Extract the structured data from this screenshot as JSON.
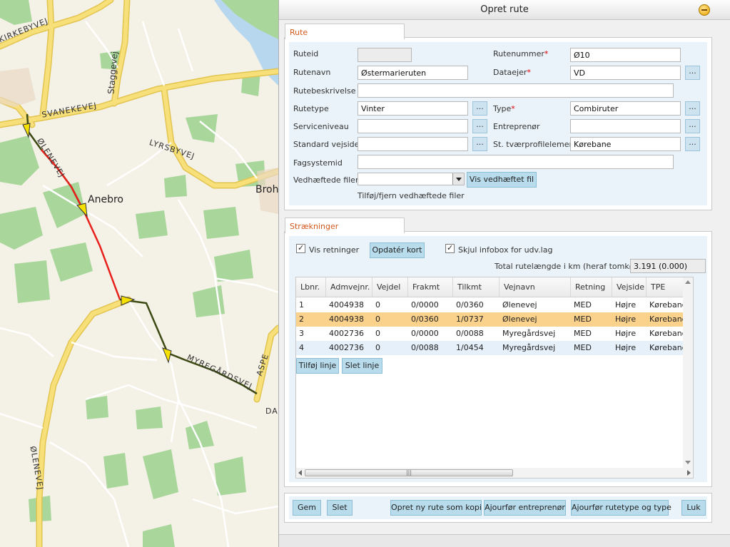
{
  "map": {
    "labels": {
      "road_1": "KIRKEBYVEJ",
      "road_2": "SVANEKEVEJ",
      "road_3": "Staggevej",
      "road_4": "LYRSBYVEJ",
      "road_5": "ØLENEVEJ",
      "town_1": "Anebro",
      "town_2": "Broh",
      "road_6": "MYREGÅRDSVEJ",
      "road_7": "ASPE",
      "road_8": "DA",
      "road_9": "ØLENEVEJ"
    },
    "colors": {
      "background": "#f4f1e6",
      "road": "#f7e07a",
      "road_border": "#e2c450",
      "green": "#a8d69b",
      "water": "#b7d7ef",
      "route_selected": "#e8201c",
      "route": "#3d4a14",
      "arrow": "#f5e000"
    }
  },
  "dialog": {
    "title": "Opret rute",
    "rute_tab": "Rute",
    "fields": {
      "ruteid_label": "Ruteid",
      "ruteid_value": "",
      "rutenummer_label": "Rutenummer",
      "rutenummer_value": "Ø10",
      "rutenavn_label": "Rutenavn",
      "rutenavn_value": "Østermarieruten",
      "dataejer_label": "Dataejer",
      "dataejer_value": "VD",
      "rutebeskrivelse_label": "Rutebeskrivelse",
      "rutebeskrivelse_value": "",
      "rutetype_label": "Rutetype",
      "rutetype_value": "Vinter",
      "type_label": "Type",
      "type_value": "Combiruter",
      "serviceniveau_label": "Serviceniveau",
      "serviceniveau_value": "",
      "entreprenor_label": "Entreprenør",
      "entreprenor_value": "",
      "standard_vejside_label": "Standard vejside",
      "standard_vejside_value": "",
      "st_tvaerprofil_label": "St. tværprofilelement",
      "st_tvaerprofil_value": "Kørebane",
      "fagsystemid_label": "Fagsystemid",
      "fagsystemid_value": "",
      "vedhaeftede_label": "Vedhæftede filer:",
      "vedhaeftede_value": "",
      "vis_vedhaeftet_button": "Vis vedhæftet fil",
      "tilfoj_fjern_text": "Tilføj/fjern vedhæftede filer",
      "required_mark": "*",
      "dots": "..."
    },
    "straekninger": {
      "tab": "Strækninger",
      "vis_retninger_label": "Vis retninger",
      "vis_retninger_checked": true,
      "opdater_kort_button": "Opdatér kort",
      "skjul_infobox_label": "Skjul infobox for udv.lag",
      "skjul_infobox_checked": true,
      "total_label": "Total rutelængde i km (heraf tomkørsel)",
      "total_value": "3.191 (0.000)",
      "columns": [
        "Lbnr.",
        "Admvejnr.",
        "Vejdel",
        "Frakmt",
        "Tilkmt",
        "Vejnavn",
        "Retning",
        "Vejside",
        "TPE"
      ],
      "rows": [
        [
          "1",
          "4004938",
          "0",
          "0/0000",
          "0/0360",
          "Ølenevej",
          "MED",
          "Højre",
          "Kørebane"
        ],
        [
          "2",
          "4004938",
          "0",
          "0/0360",
          "1/0737",
          "Ølenevej",
          "MED",
          "Højre",
          "Kørebane"
        ],
        [
          "3",
          "4002736",
          "0",
          "0/0000",
          "0/0088",
          "Myregårdsvej",
          "MED",
          "Højre",
          "Kørebane"
        ],
        [
          "4",
          "4002736",
          "0",
          "0/0088",
          "1/0454",
          "Myregårdsvej",
          "MED",
          "Højre",
          "Kørebane"
        ]
      ],
      "selected_row": 1,
      "scroll_thumb_grip": "|||",
      "tilfoj_linje_button": "Tilføj linje",
      "slet_linje_button": "Slet linje"
    },
    "footer": {
      "gem": "Gem",
      "slet": "Slet",
      "opret_kopi": "Opret ny rute som kopi",
      "ajourfor_entreprenor": "Ajourfør entreprenør",
      "ajourfor_rutetype": "Ajourfør rutetype og type",
      "luk": "Luk"
    },
    "colors": {
      "tab_text": "#d4581c",
      "selected_row": "#fbd28c",
      "alt_row": "#e6f0fa",
      "button": "#b8dcec",
      "panel_bg": "#eaf3f9"
    }
  }
}
